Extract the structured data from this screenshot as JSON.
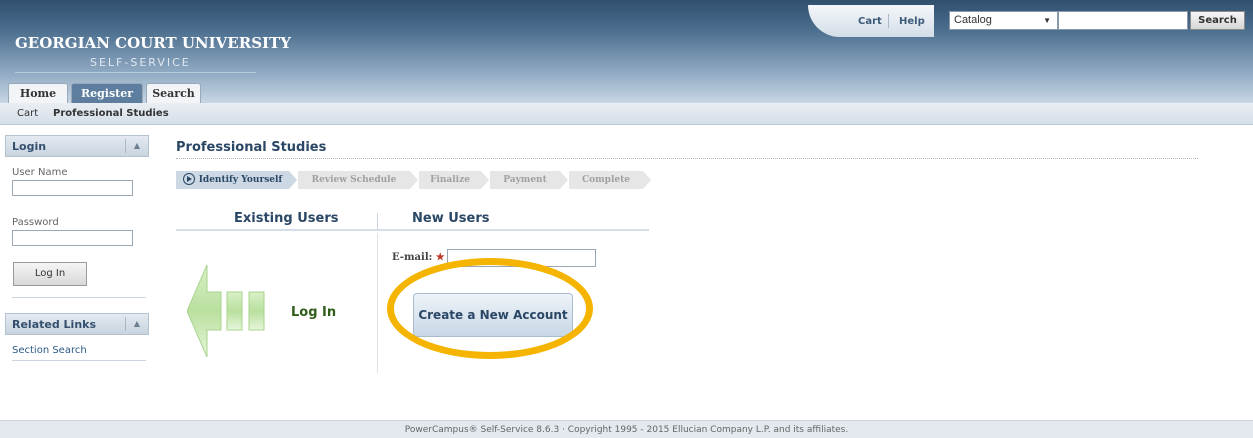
{
  "header": {
    "title": "GEORGIAN COURT UNIVERSITY",
    "subtitle": "SELF-SERVICE",
    "links": {
      "cart": "Cart",
      "help": "Help"
    },
    "catalog_select": "Catalog",
    "search_button": "Search"
  },
  "tabs": [
    {
      "label": "Home"
    },
    {
      "label": "Register"
    },
    {
      "label": "Search"
    }
  ],
  "subnav": [
    {
      "label": "Cart"
    },
    {
      "label": "Professional Studies"
    }
  ],
  "sidebar": {
    "login": {
      "title": "Login",
      "username_label": "User Name",
      "password_label": "Password",
      "login_button": "Log In"
    },
    "related_links": {
      "title": "Related Links",
      "items": [
        {
          "label": "Section Search"
        }
      ]
    }
  },
  "main": {
    "title": "Professional Studies",
    "steps": [
      {
        "label": "Identify Yourself"
      },
      {
        "label": "Review Schedule"
      },
      {
        "label": "Finalize"
      },
      {
        "label": "Payment"
      },
      {
        "label": "Complete"
      }
    ],
    "existing_users": "Existing Users",
    "new_users": "New Users",
    "login_link": "Log In",
    "email_label": "E-mail:",
    "required_mark": "★",
    "create_button": "Create a New Account"
  },
  "footer": {
    "text": "PowerCampus® Self-Service 8.6.3 · Copyright 1995 - 2015 Ellucian Company L.P. and its affiliates."
  },
  "colors": {
    "header_dark": "#2f4f6d",
    "accent_blue": "#2b4766",
    "highlight": "#f4b400",
    "login_green": "#2f5e1a"
  },
  "icons": {
    "step_active": "play-circle-icon",
    "login_arrow": "green-arrow-left-icon",
    "panel_toggle": "chevron-up-icon"
  }
}
